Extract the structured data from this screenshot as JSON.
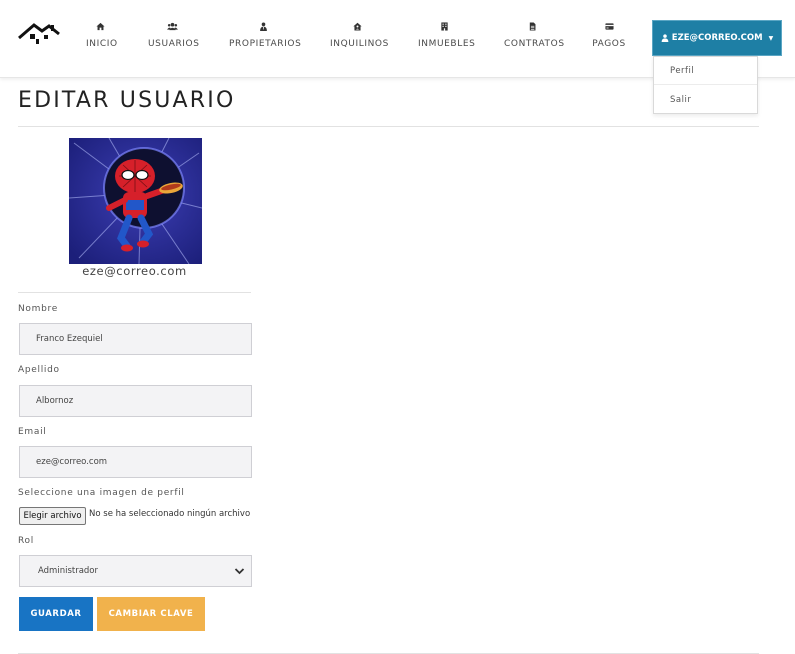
{
  "nav": {
    "items": [
      {
        "label": "INICIO",
        "icon": "home-icon"
      },
      {
        "label": "USUARIOS",
        "icon": "users-icon"
      },
      {
        "label": "PROPIETARIOS",
        "icon": "user-tie-icon"
      },
      {
        "label": "INQUILINOS",
        "icon": "house-user-icon"
      },
      {
        "label": "INMUEBLES",
        "icon": "building-icon"
      },
      {
        "label": "CONTRATOS",
        "icon": "file-icon"
      },
      {
        "label": "PAGOS",
        "icon": "credit-card-icon"
      }
    ],
    "user_label": "EZE@CORREO.COM",
    "dropdown": [
      "Perfil",
      "Salir"
    ]
  },
  "page": {
    "title": "EDITAR USUARIO",
    "avatar_caption": "eze@correo.com"
  },
  "form": {
    "nombre_label": "Nombre",
    "nombre_value": "Franco Ezequiel",
    "apellido_label": "Apellido",
    "apellido_value": "Albornoz",
    "email_label": "Email",
    "email_value": "eze@correo.com",
    "imagen_label": "Seleccione una imagen de perfil",
    "file_button": "Elegir archivo",
    "file_status": "No se ha seleccionado ningún archivo",
    "rol_label": "Rol",
    "rol_value": "Administrador",
    "save_label": "GUARDAR",
    "change_password_label": "CAMBIAR CLAVE"
  },
  "colors": {
    "primary": "#1e7fa5",
    "save": "#1874c4",
    "warning": "#f1b24c"
  }
}
